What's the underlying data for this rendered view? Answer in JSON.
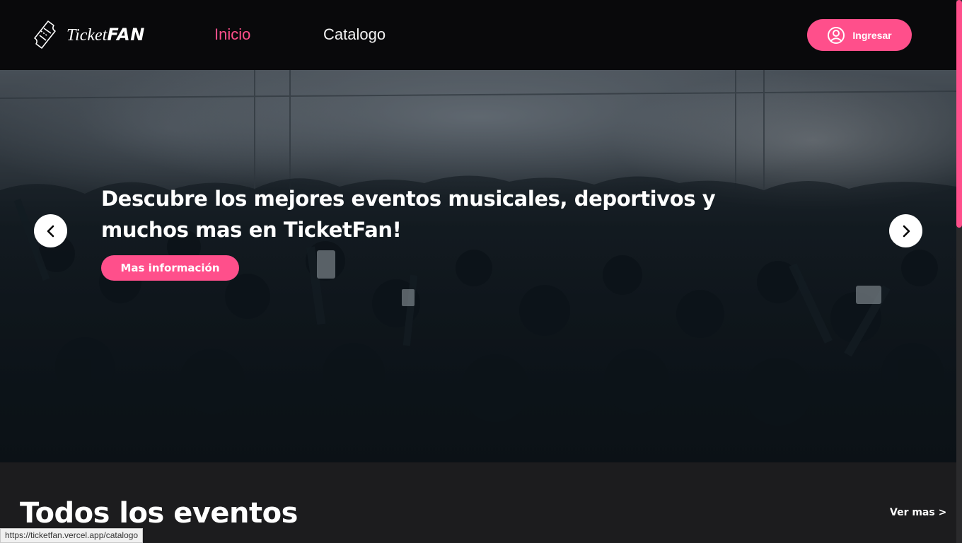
{
  "header": {
    "logo_ticket": "Ticket",
    "logo_fan": "FAN",
    "nav": [
      {
        "label": "Inicio",
        "active": true
      },
      {
        "label": "Catalogo",
        "active": false
      }
    ],
    "login_label": "Ingresar"
  },
  "hero": {
    "title": "Descubre los mejores eventos musicales, deportivos y muchos mas en TicketFan!",
    "button_label": "Mas información"
  },
  "section": {
    "title": "Todos los eventos",
    "see_more": "Ver mas >"
  },
  "status_bar": {
    "url": "https://ticketfan.vercel.app/catalogo"
  },
  "colors": {
    "accent": "#ff4f8b",
    "header_bg": "#08080a",
    "page_bg": "#1c1c1e"
  }
}
